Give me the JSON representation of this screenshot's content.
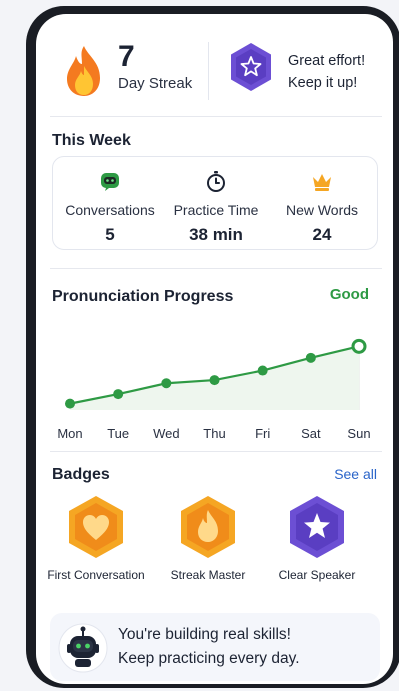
{
  "streak": {
    "count": "7",
    "label": "Day Streak",
    "message_line1": "Great effort!",
    "message_line2": "Keep it up!"
  },
  "this_week": {
    "title": "This Week",
    "items": [
      {
        "label": "Conversations",
        "value": "5",
        "icon": "robot-chat-icon"
      },
      {
        "label": "Practice Time",
        "value": "38 min",
        "icon": "stopwatch-icon"
      },
      {
        "label": "New Words",
        "value": "24",
        "icon": "crown-icon"
      }
    ]
  },
  "pronunciation": {
    "title": "Pronunciation Progress",
    "status": "Good",
    "status_color": "#2e9a44"
  },
  "chart_data": {
    "type": "line",
    "categories": [
      "Mon",
      "Tue",
      "Wed",
      "Thu",
      "Fri",
      "Sat",
      "Sun"
    ],
    "values": [
      0.1,
      0.25,
      0.42,
      0.47,
      0.62,
      0.82,
      1.0
    ],
    "title": "Pronunciation Progress",
    "ylim": [
      0,
      1.1
    ],
    "grid": true,
    "color": "#2e9a44"
  },
  "badges": {
    "title": "Badges",
    "see_all": "See all",
    "items": [
      {
        "label": "First Conversation",
        "icon": "heart-icon",
        "color": "#f5a623"
      },
      {
        "label": "Streak Master",
        "icon": "flame-icon",
        "color": "#f5a623"
      },
      {
        "label": "Clear Speaker",
        "icon": "star-icon",
        "color": "#6c4fd4"
      }
    ]
  },
  "footer": {
    "line1": "You're building real skills!",
    "line2": "Keep practicing every day."
  },
  "colors": {
    "accent_green": "#2e9a44",
    "link_blue": "#2a64c9",
    "purple": "#6c4fd4",
    "orange": "#f5a623"
  }
}
